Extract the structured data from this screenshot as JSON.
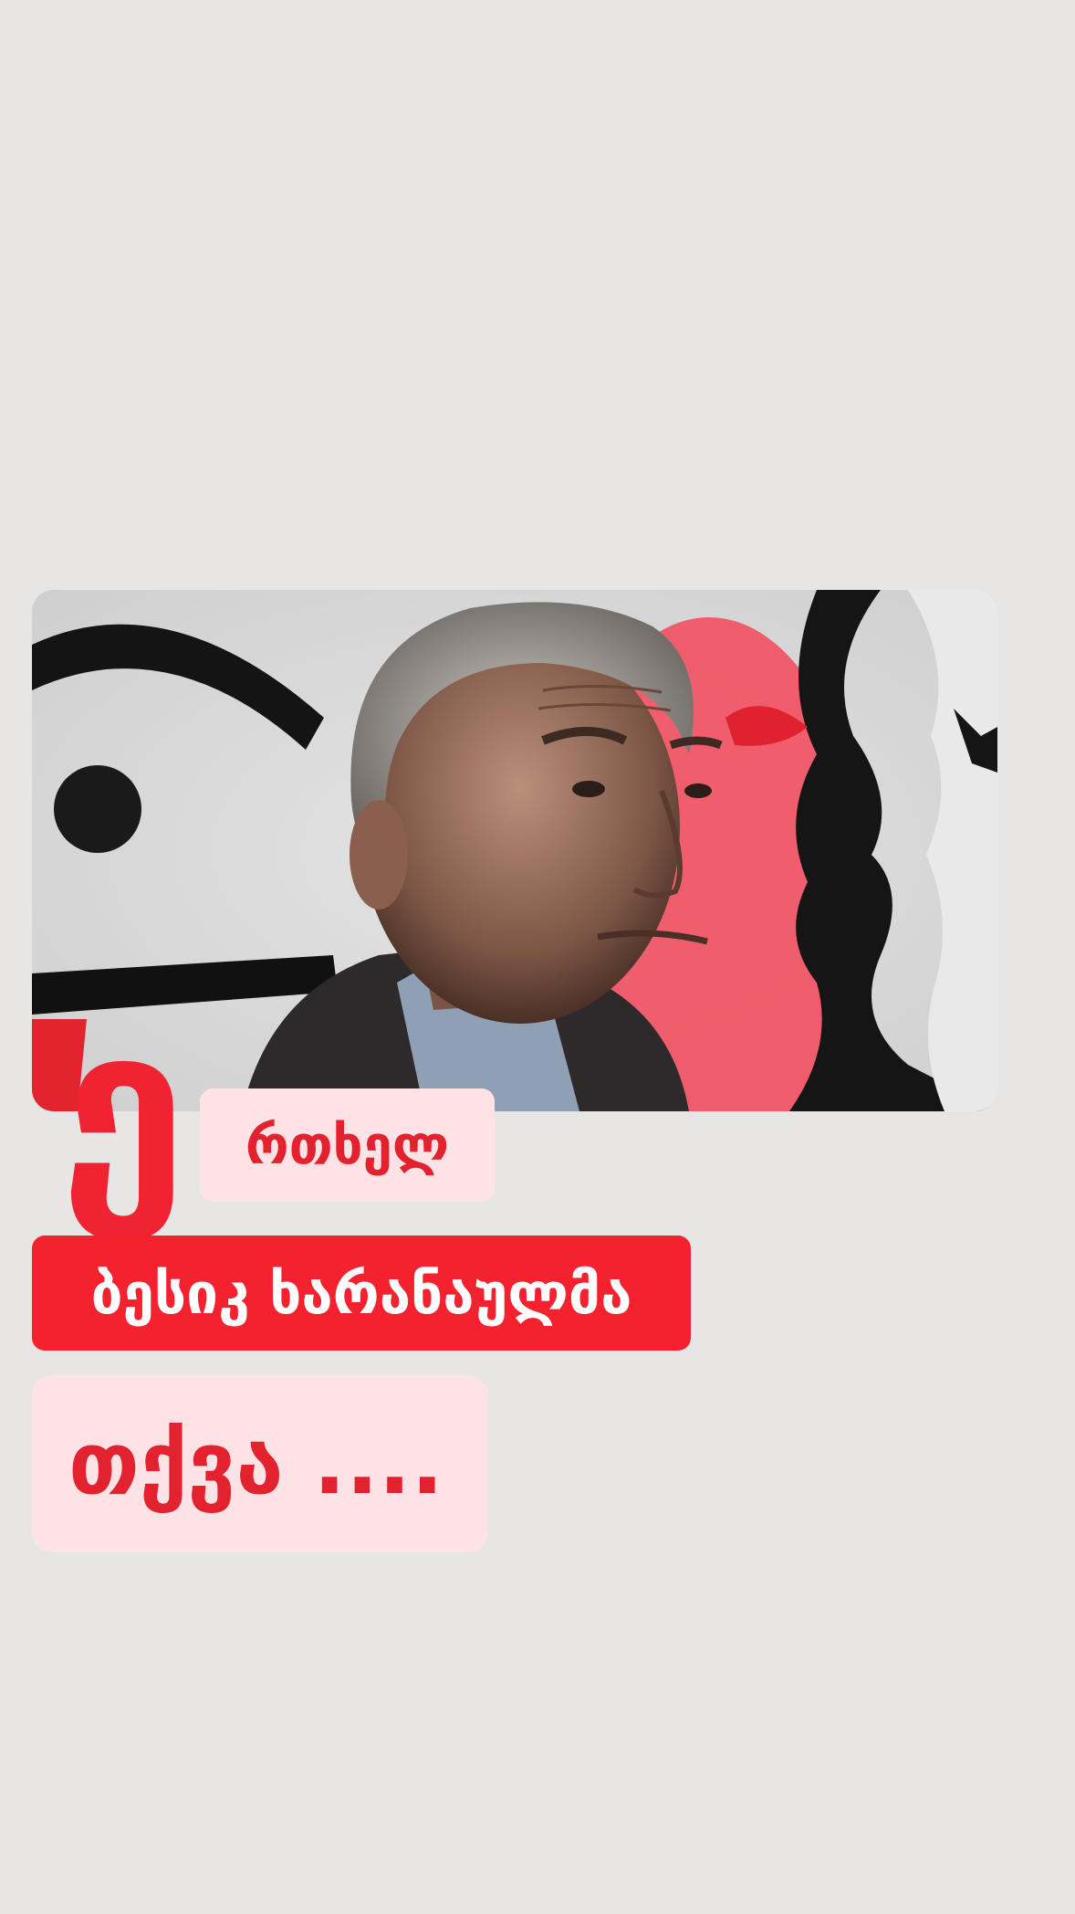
{
  "post": {
    "photo_alt": "portrait photo",
    "drop_cap": "ე",
    "title_line1": "რთხელ",
    "title_line2": "ბესიკ ხარანაულმა",
    "title_line3": "თქვა ...."
  },
  "colors": {
    "background": "#e7e6e5",
    "accent_red": "#f4222f",
    "light_pink": "#fde3e5"
  }
}
